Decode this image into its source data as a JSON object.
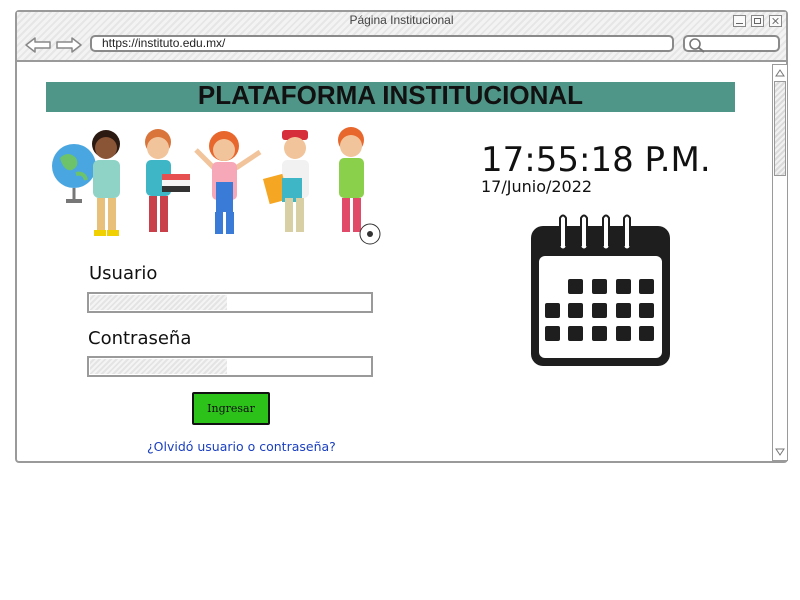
{
  "window": {
    "title": "Página Institucional",
    "url": "https://instituto.edu.mx/"
  },
  "page": {
    "banner_title": "PLATAFORMA INSTITUCIONAL",
    "clock_time": "17:55:18 P.M.",
    "clock_date": "17/Junio/2022",
    "form": {
      "username_label": "Usuario",
      "username_value": "",
      "password_label": "Contraseña",
      "password_value": "",
      "submit_label": "Ingresar",
      "forgot_link": "¿Olvidó usuario o contraseña?"
    }
  },
  "colors": {
    "banner": "#4f9688",
    "button": "#2cc21a",
    "link": "#1a3fbf"
  },
  "icons": [
    "back-arrow-icon",
    "forward-arrow-icon",
    "search-icon",
    "minimize-icon",
    "maximize-icon",
    "close-icon",
    "calendar-icon",
    "scroll-up-icon",
    "scroll-down-icon"
  ]
}
